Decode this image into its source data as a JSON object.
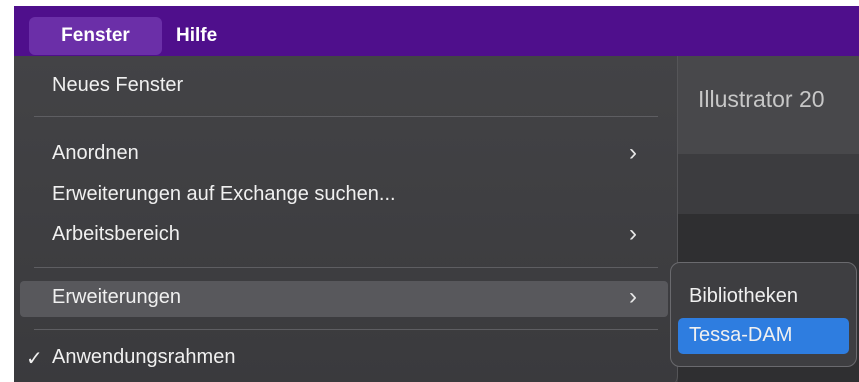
{
  "menubar": {
    "items": [
      {
        "label": "Fenster",
        "active": true
      },
      {
        "label": "Hilfe",
        "active": false
      }
    ],
    "color": "#4f0f8c"
  },
  "background_window": {
    "title": "Illustrator 20"
  },
  "fenster_menu": {
    "items": [
      {
        "label": "Neues Fenster",
        "submenu": false
      },
      {
        "label": "Anordnen",
        "submenu": true
      },
      {
        "label": "Erweiterungen auf Exchange suchen...",
        "submenu": false
      },
      {
        "label": "Arbeitsbereich",
        "submenu": true
      },
      {
        "label": "Erweiterungen",
        "submenu": true,
        "highlighted": true
      },
      {
        "label": "Anwendungsrahmen",
        "submenu": false,
        "checked": true
      }
    ],
    "chevron": "›",
    "checkmark": "✓"
  },
  "erweiterungen_submenu": {
    "items": [
      {
        "label": "Bibliotheken",
        "selected": false
      },
      {
        "label": "Tessa-DAM",
        "selected": true
      }
    ],
    "selection_color": "#2e7de0"
  }
}
